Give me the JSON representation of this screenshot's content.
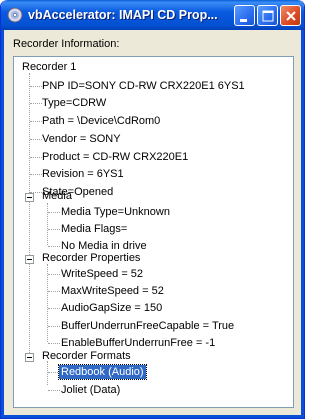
{
  "window": {
    "title": "vbAccelerator: IMAPI CD Prop..."
  },
  "section_label": "Recorder Information:",
  "tree": {
    "root": "Recorder 1",
    "properties": [
      "PNP ID=SONY CD-RW CRX220E1 6YS1",
      "Type=CDRW",
      "Path = \\Device\\CdRom0",
      "Vendor = SONY",
      "Product = CD-RW CRX220E1",
      "Revision = 6YS1",
      "State=Opened"
    ],
    "media": {
      "label": "Media",
      "items": [
        "Media Type=Unknown",
        "Media Flags=",
        "No Media in drive"
      ]
    },
    "recorder_properties": {
      "label": "Recorder Properties",
      "items": [
        "WriteSpeed = 52",
        "MaxWriteSpeed = 52",
        "AudioGapSize = 150",
        "BufferUnderrunFreeCapable = True",
        "EnableBufferUnderrunFree = -1"
      ]
    },
    "recorder_formats": {
      "label": "Recorder Formats",
      "items": [
        "Redbook (Audio)",
        "Joliet (Data)"
      ],
      "selected_index": 0
    }
  },
  "colors": {
    "titlebar": "#0450d2",
    "selection": "#316ac5",
    "dialog_bg": "#ece9d8"
  }
}
